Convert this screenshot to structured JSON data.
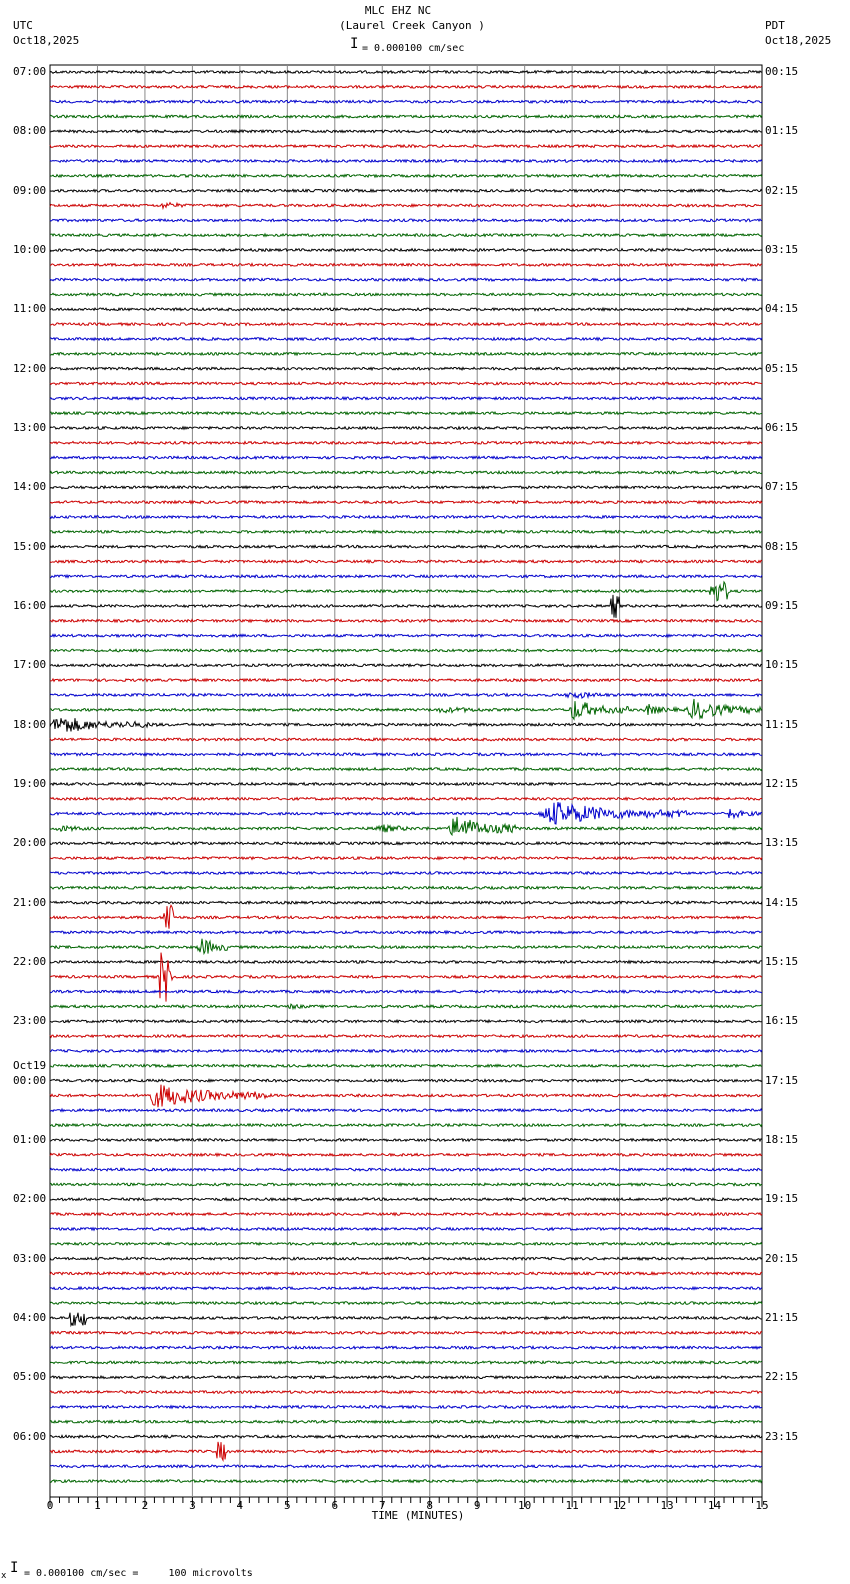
{
  "header": {
    "title": "MLC EHZ NC",
    "subtitle": "(Laurel Creek Canyon )",
    "left_tz": "UTC",
    "left_date": "Oct18,2025",
    "right_tz": "PDT",
    "right_date": "Oct18,2025",
    "scale_text": "= 0.000100 cm/sec"
  },
  "footer": {
    "scale_text": "= 0.000100 cm/sec =     100 microvolts",
    "marker": "x"
  },
  "chart_data": {
    "type": "line",
    "title": "MLC EHZ NC (Laurel Creek Canyon )",
    "xlabel": "TIME (MINUTES)",
    "xlim": [
      0,
      15
    ],
    "x_ticks": [
      "0",
      "1",
      "2",
      "3",
      "4",
      "5",
      "6",
      "7",
      "8",
      "9",
      "10",
      "11",
      "12",
      "13",
      "14",
      "15"
    ],
    "traces_per_hour": 4,
    "trace_colors": [
      "#000000",
      "#cc0000",
      "#0000cc",
      "#006400"
    ],
    "left_labels": [
      "07:00",
      "08:00",
      "09:00",
      "10:00",
      "11:00",
      "12:00",
      "13:00",
      "14:00",
      "15:00",
      "16:00",
      "17:00",
      "18:00",
      "19:00",
      "20:00",
      "21:00",
      "22:00",
      "23:00",
      "00:00",
      "01:00",
      "02:00",
      "03:00",
      "04:00",
      "05:00",
      "06:00"
    ],
    "date_change_label": {
      "hour_index": 17,
      "text": "Oct19"
    },
    "right_labels": [
      "00:15",
      "01:15",
      "02:15",
      "03:15",
      "04:15",
      "05:15",
      "06:15",
      "07:15",
      "08:15",
      "09:15",
      "10:15",
      "11:15",
      "12:15",
      "13:15",
      "14:15",
      "15:15",
      "16:15",
      "17:15",
      "18:15",
      "19:15",
      "20:15",
      "21:15",
      "22:15",
      "23:15"
    ],
    "events": [
      {
        "trace": 9,
        "start": 2.3,
        "end": 3.3,
        "amp": 5
      },
      {
        "trace": 35,
        "start": 13.9,
        "end": 14.3,
        "amp": 10
      },
      {
        "trace": 36,
        "start": 11.8,
        "end": 12.0,
        "amp": 12
      },
      {
        "trace": 42,
        "start": 10.8,
        "end": 12.6,
        "amp": 5
      },
      {
        "trace": 43,
        "start": 8.0,
        "end": 10.8,
        "amp": 4
      },
      {
        "trace": 43,
        "start": 10.9,
        "end": 12.2,
        "amp": 14
      },
      {
        "trace": 43,
        "start": 12.5,
        "end": 13.3,
        "amp": 8
      },
      {
        "trace": 43,
        "start": 13.4,
        "end": 15.0,
        "amp": 14
      },
      {
        "trace": 44,
        "start": 0.0,
        "end": 1.8,
        "amp": 13
      },
      {
        "trace": 44,
        "start": 1.8,
        "end": 3.0,
        "amp": 4
      },
      {
        "trace": 50,
        "start": 10.3,
        "end": 13.4,
        "amp": 16
      },
      {
        "trace": 50,
        "start": 14.2,
        "end": 15.0,
        "amp": 8
      },
      {
        "trace": 51,
        "start": 0.0,
        "end": 2.0,
        "amp": 4
      },
      {
        "trace": 51,
        "start": 6.8,
        "end": 8.2,
        "amp": 6
      },
      {
        "trace": 51,
        "start": 8.4,
        "end": 9.8,
        "amp": 18
      },
      {
        "trace": 59,
        "start": 3.1,
        "end": 3.8,
        "amp": 14
      },
      {
        "trace": 57,
        "start": 2.4,
        "end": 2.6,
        "amp": 20
      },
      {
        "trace": 61,
        "start": 2.3,
        "end": 2.6,
        "amp": 25
      },
      {
        "trace": 63,
        "start": 5.0,
        "end": 5.8,
        "amp": 4
      },
      {
        "trace": 69,
        "start": 2.0,
        "end": 4.6,
        "amp": 16
      },
      {
        "trace": 84,
        "start": 0.4,
        "end": 0.8,
        "amp": 8
      },
      {
        "trace": 93,
        "start": 3.5,
        "end": 3.7,
        "amp": 10
      }
    ]
  }
}
